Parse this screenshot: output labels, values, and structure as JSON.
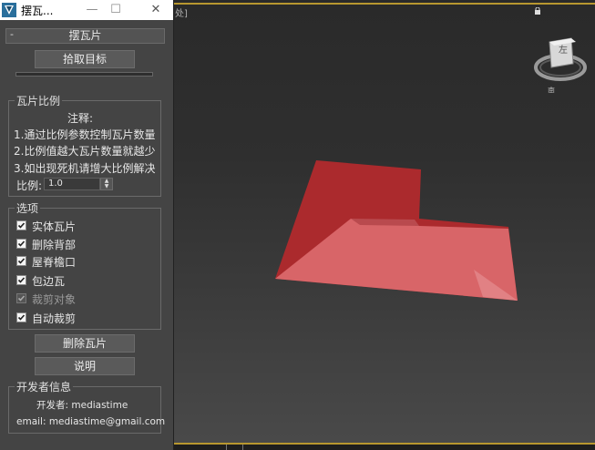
{
  "window": {
    "title": "摆瓦...",
    "minimize": "—",
    "maximize": "☐",
    "close": "✕"
  },
  "rollout": {
    "collapse_symbol": "-",
    "title": "摆瓦片"
  },
  "pick_button": "拾取目标",
  "ratio_group": {
    "title": "瓦片比例",
    "note_heading": "注释:",
    "notes": [
      "1.通过比例参数控制瓦片数量",
      "2.比例值越大瓦片数量就越少",
      "3.如出现死机请增大比例解决"
    ],
    "ratio_label": "比例:",
    "ratio_value": "1.0"
  },
  "options_group": {
    "title": "选项",
    "items": [
      {
        "label": "实体瓦片",
        "checked": true,
        "enabled": true
      },
      {
        "label": "删除背部",
        "checked": true,
        "enabled": true
      },
      {
        "label": "屋脊檐口",
        "checked": true,
        "enabled": true
      },
      {
        "label": "包边瓦",
        "checked": true,
        "enabled": true
      },
      {
        "label": "裁剪对象",
        "checked": true,
        "enabled": false
      },
      {
        "label": "自动裁剪",
        "checked": true,
        "enabled": true
      }
    ]
  },
  "delete_button": "删除瓦片",
  "help_button": "说明",
  "developer_group": {
    "title": "开发者信息",
    "developer": "开发者: mediastime",
    "email": "email: mediastime@gmail.com"
  },
  "viewport": {
    "label": "处]",
    "viewcube": {
      "face": "左",
      "compass": "南"
    }
  },
  "colors": {
    "roof_top": "#ab2a2d",
    "roof_side": "#d86568",
    "selection_border": "#b8972f",
    "panel_bg": "#444444"
  }
}
